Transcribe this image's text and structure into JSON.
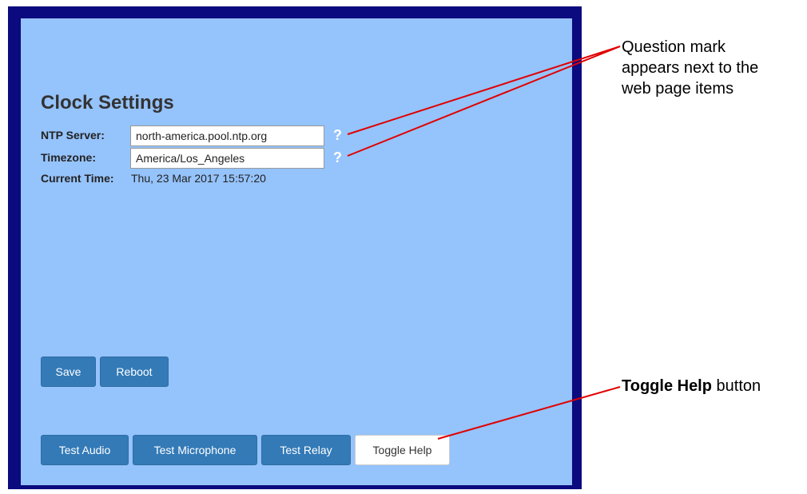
{
  "page": {
    "title": "Clock Settings"
  },
  "form": {
    "ntp_label": "NTP Server:",
    "ntp_value": "north-america.pool.ntp.org",
    "timezone_label": "Timezone:",
    "timezone_value": "America/Los_Angeles",
    "current_time_label": "Current Time:",
    "current_time_value": "Thu, 23 Mar 2017 15:57:20",
    "help_glyph": "?"
  },
  "buttons": {
    "save": "Save",
    "reboot": "Reboot",
    "test_audio": "Test Audio",
    "test_microphone": "Test Microphone",
    "test_relay": "Test Relay",
    "toggle_help": "Toggle Help"
  },
  "annotations": {
    "question_mark_line1": "Question mark",
    "question_mark_line2": "appears next to the",
    "question_mark_line3": "web page items",
    "toggle_help_bold": "Toggle Help",
    "toggle_help_suffix": " button"
  },
  "colors": {
    "frame": "#0b0a7e",
    "panel": "#95c3fb",
    "primary_button": "#337ab7",
    "callout_line": "#e00000"
  }
}
